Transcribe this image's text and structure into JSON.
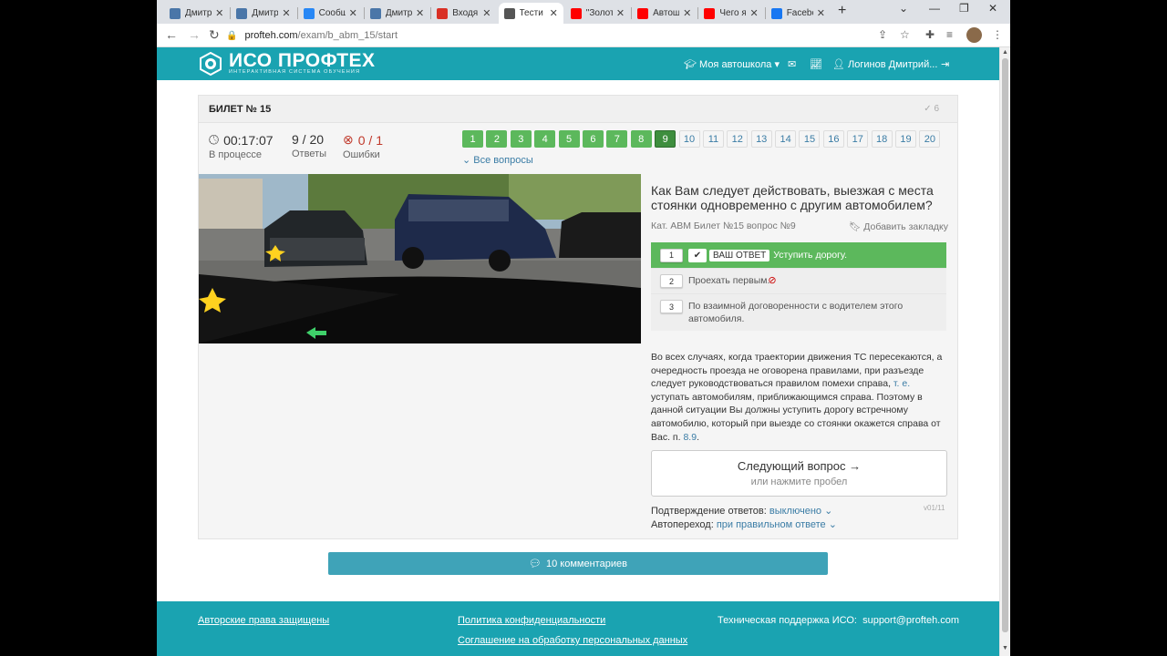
{
  "browser": {
    "tabs": [
      {
        "title": "Дмитр",
        "icon": "vk-icon",
        "color": "#4a76a8"
      },
      {
        "title": "Дмитр",
        "icon": "vk-icon",
        "color": "#4a76a8"
      },
      {
        "title": "Сообщ",
        "icon": "vk-messenger-icon",
        "color": "#2787f5"
      },
      {
        "title": "Дмитр",
        "icon": "vk-icon",
        "color": "#4a76a8"
      },
      {
        "title": "Входя",
        "icon": "gmail-icon",
        "color": "#d93025"
      },
      {
        "title": "Тести",
        "icon": "profteh-icon",
        "color": "#555555"
      },
      {
        "title": "\"Золот",
        "icon": "youtube-icon",
        "color": "#ff0000"
      },
      {
        "title": "Автош",
        "icon": "youtube-icon",
        "color": "#ff0000"
      },
      {
        "title": "Чего я",
        "icon": "youtube-icon",
        "color": "#ff0000"
      },
      {
        "title": "Facebo",
        "icon": "facebook-icon",
        "color": "#1877f2"
      }
    ],
    "url_host": "profteh.com",
    "url_path": "/exam/b_abm_15/start"
  },
  "site": {
    "logo_title": "ИСО ПРОФТЕХ",
    "logo_subtitle": "ИНТЕРАКТИВНАЯ СИСТЕМА ОБУЧЕНИЯ",
    "nav_school": "Моя автошкола",
    "nav_user": "Логинов Дмитрий..."
  },
  "exam": {
    "ticket_title": "БИЛЕТ № 15",
    "correct_count": "6",
    "timer_value": "00:17:07",
    "timer_label": "В процессе",
    "answers_value": "9 / 20",
    "answers_label": "Ответы",
    "errors_value": "0 / 1",
    "errors_label": "Ошибки",
    "question_numbers": [
      {
        "n": "1",
        "state": "done"
      },
      {
        "n": "2",
        "state": "done"
      },
      {
        "n": "3",
        "state": "done"
      },
      {
        "n": "4",
        "state": "done"
      },
      {
        "n": "5",
        "state": "done"
      },
      {
        "n": "6",
        "state": "done"
      },
      {
        "n": "7",
        "state": "done"
      },
      {
        "n": "8",
        "state": "done"
      },
      {
        "n": "9",
        "state": "cur"
      },
      {
        "n": "10",
        "state": "todo"
      },
      {
        "n": "11",
        "state": "todo"
      },
      {
        "n": "12",
        "state": "todo"
      },
      {
        "n": "13",
        "state": "todo"
      },
      {
        "n": "14",
        "state": "todo"
      },
      {
        "n": "15",
        "state": "todo"
      },
      {
        "n": "16",
        "state": "todo"
      },
      {
        "n": "17",
        "state": "todo"
      },
      {
        "n": "18",
        "state": "todo"
      },
      {
        "n": "19",
        "state": "todo"
      },
      {
        "n": "20",
        "state": "todo"
      }
    ],
    "all_questions_label": "Все вопросы",
    "question_text": "Как Вам следует действовать, выезжая с места стоянки одновременно с другим автомобилем?",
    "question_meta": "Кат. ABM   Билет №15   вопрос №9",
    "bookmark_label": "Добавить закладку",
    "your_answer_label": "ВАШ ОТВЕТ",
    "answers": [
      {
        "num": "1",
        "text": "Уступить дорогу."
      },
      {
        "num": "2",
        "text": "Проехать первым."
      },
      {
        "num": "3",
        "text": "По взаимной договоренности с водителем этого автомобиля."
      }
    ],
    "explanation_part1": "Во всех случаях, когда траектории движения ТС пересекаются, а очередность проезда не оговорена правилами, при разъезде следует руководствоваться правилом помехи справа, ",
    "explanation_link1": "т. е.",
    "explanation_part2": " уступать автомобилям, приближающимся справа. Поэтому в данной ситуации Вы должны уступить дорогу встречному автомобилю, который при выезде со стоянки окажется справа от Вас. п. ",
    "explanation_link2": "8.9",
    "explanation_end": ".",
    "next_button": "Следующий вопрос →",
    "next_hint": "или нажмите пробел",
    "version": "v01/11",
    "confirm_label": "Подтверждение ответов: ",
    "confirm_value": "выключено",
    "autojump_label": "Автопереход: ",
    "autojump_value": "при правильном ответе",
    "comments_label": "10 комментариев"
  },
  "footer": {
    "copyright": "Авторские права защищены",
    "privacy": "Политика конфиденциальности",
    "consent": "Соглашение на обработку персональных данных",
    "support_label": "Техническая поддержка ИСО:",
    "support_email": "support@profteh.com"
  },
  "colors": {
    "brand": "#1aa3b1",
    "correct": "#5cb85c",
    "link": "#3a7ca5"
  }
}
